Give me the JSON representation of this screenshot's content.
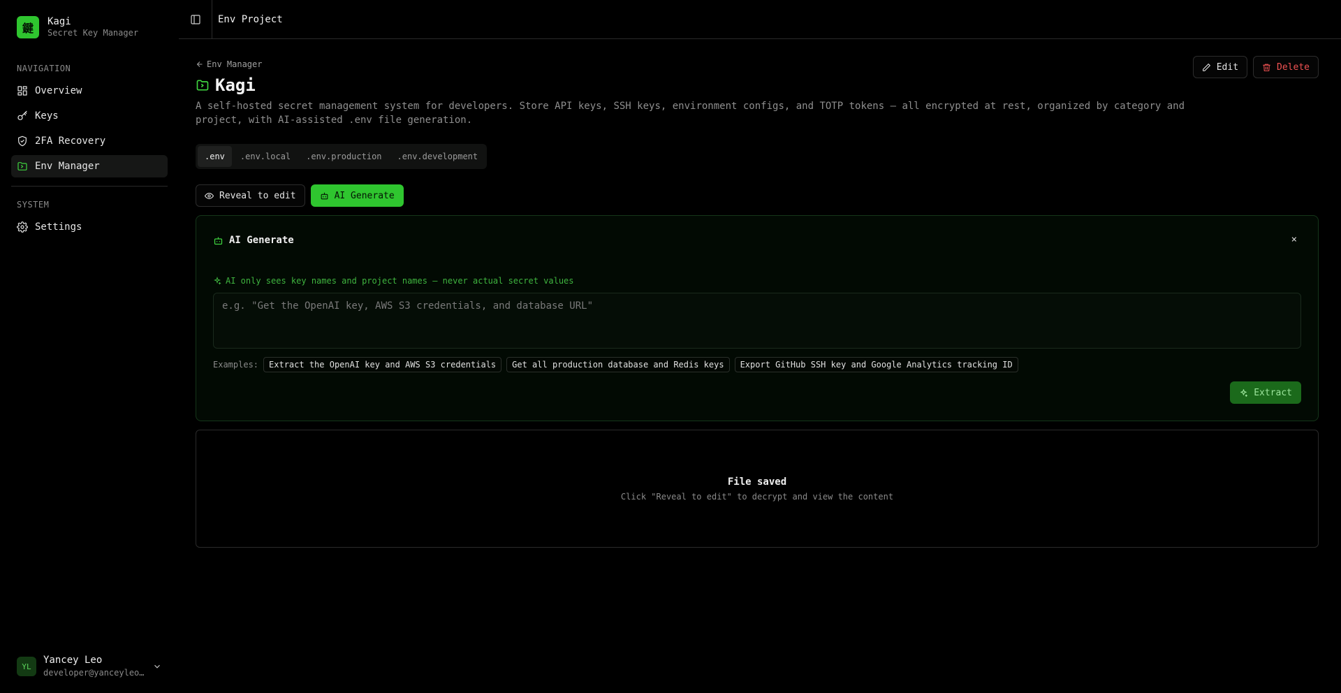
{
  "brand": {
    "logo": "鍵",
    "name": "Kagi",
    "subtitle": "Secret Key Manager"
  },
  "navigation": {
    "label": "NAVIGATION",
    "items": [
      {
        "label": "Overview",
        "icon": "grid-icon"
      },
      {
        "label": "Keys",
        "icon": "key-icon"
      },
      {
        "label": "2FA Recovery",
        "icon": "shield-check-icon"
      },
      {
        "label": "Env Manager",
        "icon": "folder-icon",
        "active": true
      }
    ]
  },
  "system": {
    "label": "SYSTEM",
    "items": [
      {
        "label": "Settings",
        "icon": "gear-icon"
      }
    ]
  },
  "user": {
    "initials": "YL",
    "name": "Yancey Leo",
    "email": "developer@yanceyleo.com"
  },
  "topbar": {
    "title": "Env Project"
  },
  "breadcrumb": {
    "back_label": "Env Manager"
  },
  "project": {
    "title": "Kagi",
    "description": "A self-hosted secret management system for developers. Store API keys, SSH keys, environment configs, and TOTP tokens — all encrypted at rest, organized by category and project, with AI-assisted .env file generation."
  },
  "header_actions": {
    "edit": "Edit",
    "delete": "Delete"
  },
  "tabs": [
    ".env",
    ".env.local",
    ".env.production",
    ".env.development"
  ],
  "actions": {
    "reveal": "Reveal to edit",
    "ai_generate": "AI Generate"
  },
  "ai_panel": {
    "title": "AI Generate",
    "close": "×",
    "note": "AI only sees key names and project names — never actual secret values",
    "placeholder": "e.g. \"Get the OpenAI key, AWS S3 credentials, and database URL\"",
    "examples_label": "Examples:",
    "examples": [
      "Extract the OpenAI key and AWS S3 credentials",
      "Get all production database and Redis keys",
      "Export GitHub SSH key and Google Analytics tracking ID"
    ],
    "extract": "Extract"
  },
  "saved": {
    "title": "File saved",
    "subtitle": "Click \"Reveal to edit\" to decrypt and view the content"
  },
  "colors": {
    "accent": "#2fc52f",
    "danger": "#f05252",
    "background": "#000000"
  }
}
